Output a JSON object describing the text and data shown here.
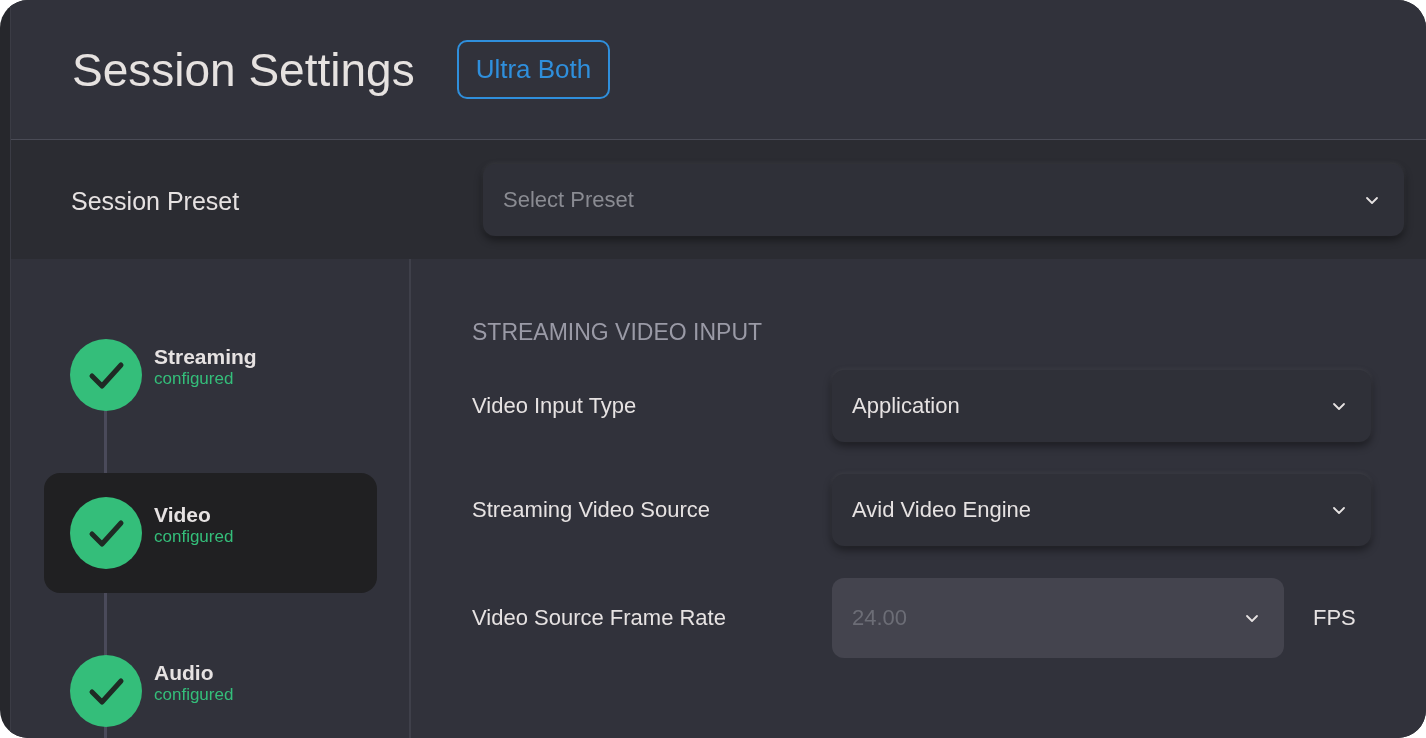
{
  "window": {
    "title": "Session Settings",
    "badge": "Ultra Both"
  },
  "preset": {
    "label": "Session Preset",
    "placeholder": "Select Preset"
  },
  "steps": [
    {
      "label": "Streaming",
      "status": "configured",
      "completed": true,
      "selected": false
    },
    {
      "label": "Video",
      "status": "configured",
      "completed": true,
      "selected": true
    },
    {
      "label": "Audio",
      "status": "configured",
      "completed": true,
      "selected": false
    }
  ],
  "section": {
    "heading": "STREAMING VIDEO INPUT",
    "fields": [
      {
        "label": "Video Input Type",
        "value": "Application",
        "disabled": false
      },
      {
        "label": "Streaming Video Source",
        "value": "Avid Video Engine",
        "disabled": false
      },
      {
        "label": "Video Source Frame Rate",
        "value": "24.00",
        "disabled": true,
        "unit": "FPS"
      }
    ]
  }
}
